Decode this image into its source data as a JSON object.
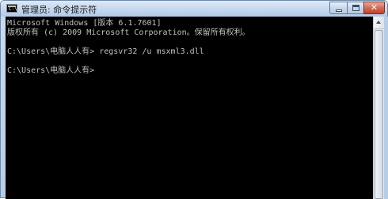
{
  "window": {
    "title": "管理员: 命令提示符",
    "icon": "cmd-console-icon",
    "icon_glyph": "C:\\",
    "close_symbol": "✕"
  },
  "console": {
    "lines": [
      "Microsoft Windows [版本 6.1.7601]",
      "版权所有 (c) 2009 Microsoft Corporation。保留所有权利。",
      "C:\\Users\\电脑人人有> regsvr32 /u msxml3.dll",
      "C:\\Users\\电脑人人有>"
    ],
    "text_color": "#c0c0c0",
    "background_color": "#000000"
  }
}
